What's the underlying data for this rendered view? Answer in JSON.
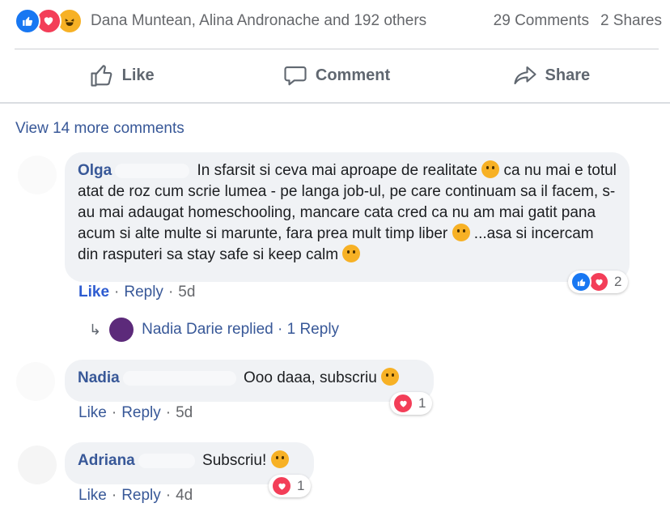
{
  "summary": {
    "names": "Dana Muntean, Alina Andronache and 192 others",
    "comments": "29 Comments",
    "shares": "2 Shares"
  },
  "actions": {
    "like": "Like",
    "comment": "Comment",
    "share": "Share"
  },
  "view_more": "View 14 more comments",
  "comments": [
    {
      "author": "Olga",
      "text_1": "In sfarsit si ceva mai aproape de realitate",
      "text_2": "ca nu mai e totul atat de roz cum scrie lumea - pe langa job-ul, pe care continuam sa il facem, s-au mai adaugat homeschooling, mancare cata cred ca nu am mai gatit pana acum si alte multe si marunte, fara prea mult timp liber",
      "text_3": "...asa si incercam din rasputeri sa stay safe si keep calm",
      "like": "Like",
      "reply": "Reply",
      "time": "5d",
      "reaction_count": "2",
      "replied_text": "Nadia Darie replied · 1 Reply"
    },
    {
      "author": "Nadia",
      "text": "Ooo daaa, subscriu",
      "like": "Like",
      "reply": "Reply",
      "time": "5d",
      "reaction_count": "1"
    },
    {
      "author": "Adriana",
      "text": "Subscriu!",
      "like": "Like",
      "reply": "Reply",
      "time": "4d",
      "reaction_count": "1"
    }
  ],
  "colors": {
    "link_blue": "#385898",
    "like_blue": "#1877f2",
    "love_red": "#f33e58",
    "haha_yellow": "#f7b125"
  }
}
